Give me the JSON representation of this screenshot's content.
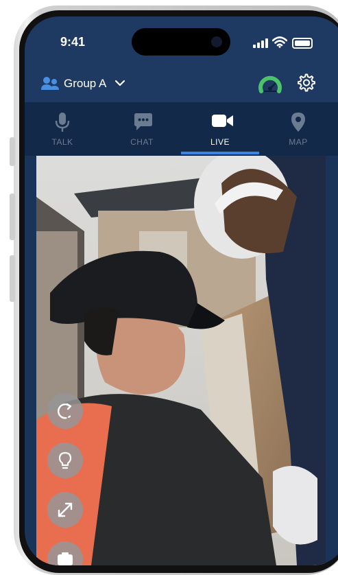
{
  "status_bar": {
    "time": "9:41"
  },
  "header": {
    "group_name": "Group A",
    "group_icon": "group-users-icon",
    "dropdown_icon": "chevron-down-icon",
    "status_icon": "signal-gauge-icon",
    "settings_icon": "gear-icon"
  },
  "tabs": [
    {
      "label": "TALK",
      "icon": "microphone-icon",
      "active": false
    },
    {
      "label": "CHAT",
      "icon": "chat-bubble-icon",
      "active": false
    },
    {
      "label": "LIVE",
      "icon": "video-camera-icon",
      "active": true
    },
    {
      "label": "MAP",
      "icon": "map-pin-icon",
      "active": false
    }
  ],
  "video_controls": [
    {
      "icon": "rotate-camera-icon"
    },
    {
      "icon": "light-bulb-icon"
    },
    {
      "icon": "expand-icon"
    },
    {
      "icon": "camera-switch-icon"
    }
  ],
  "colors": {
    "header_bg": "#1e3a63",
    "tab_bar_bg": "#132949",
    "accent": "#3c86e3",
    "inactive_tab": "#6b7b92",
    "gauge_green": "#4cc26b"
  }
}
